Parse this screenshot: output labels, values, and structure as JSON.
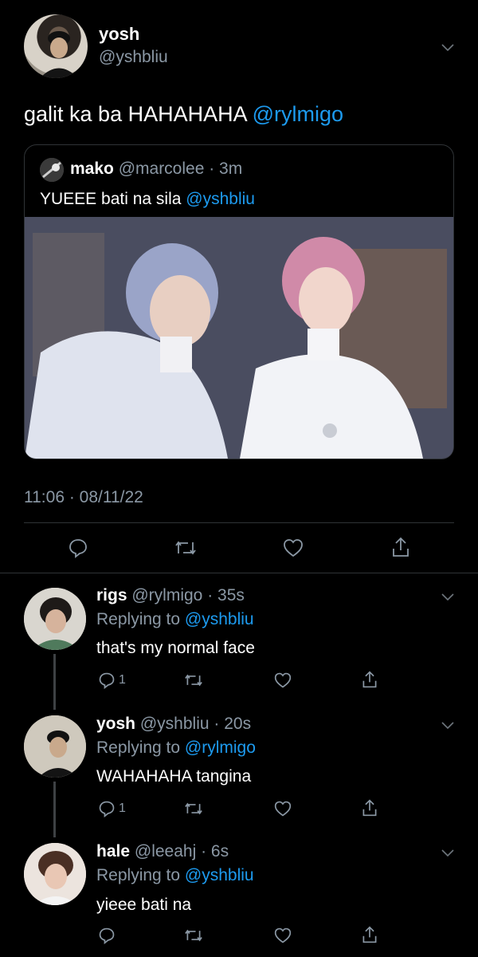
{
  "main_tweet": {
    "display_name": "yosh",
    "handle": "@yshbliu",
    "text": "galit ka ba HAHAHAHA ",
    "mention": "@rylmigo",
    "timestamp": "11:06 · 08/11/22"
  },
  "quoted_tweet": {
    "display_name": "mako",
    "handle": "@marcolee",
    "time": "· 3m",
    "text": "YUEEE bati na sila ",
    "mention": "@yshbliu"
  },
  "replies": [
    {
      "display_name": "rigs",
      "handle": "@rylmigo",
      "time": "· 35s",
      "replying_prefix": "Replying to ",
      "replying_to": "@yshbliu",
      "text": "that's my normal face",
      "reply_count": "1"
    },
    {
      "display_name": "yosh",
      "handle": "@yshbliu",
      "time": "· 20s",
      "replying_prefix": "Replying to ",
      "replying_to": "@rylmigo",
      "text": "WAHAHAHA tangina",
      "reply_count": "1"
    },
    {
      "display_name": "hale",
      "handle": "@leeahj",
      "time": "· 6s",
      "replying_prefix": "Replying to ",
      "replying_to": "@yshbliu",
      "text": "yieee bati na",
      "reply_count": ""
    }
  ],
  "colors": {
    "background": "#000000",
    "accent": "#1d9bf0",
    "muted": "#8b98a5",
    "divider": "#2f3336"
  },
  "icons": [
    "chevron-down-icon",
    "reply-icon",
    "retweet-icon",
    "like-icon",
    "share-icon"
  ]
}
